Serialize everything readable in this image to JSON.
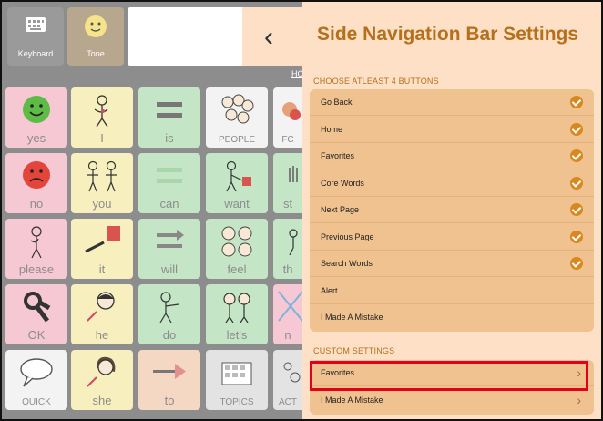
{
  "toolbar": {
    "keyboard_label": "Keyboard",
    "tone_label": "Tone",
    "home_link": "HO"
  },
  "grid": {
    "cells": [
      {
        "label": "yes"
      },
      {
        "label": "I"
      },
      {
        "label": "is"
      },
      {
        "label": "PEOPLE"
      },
      {
        "label": "FC"
      },
      {
        "label": "no"
      },
      {
        "label": "you"
      },
      {
        "label": "can"
      },
      {
        "label": "want"
      },
      {
        "label": "st"
      },
      {
        "label": "please"
      },
      {
        "label": "it"
      },
      {
        "label": "will"
      },
      {
        "label": "feel"
      },
      {
        "label": "th"
      },
      {
        "label": "OK"
      },
      {
        "label": "he"
      },
      {
        "label": "do"
      },
      {
        "label": "let's"
      },
      {
        "label": "n"
      },
      {
        "label": "QUICK"
      },
      {
        "label": "she"
      },
      {
        "label": "to"
      },
      {
        "label": "TOPICS"
      },
      {
        "label": "ACT"
      }
    ]
  },
  "panel": {
    "title": "Side Navigation Bar Settings",
    "section1_header": "CHOOSE ATLEAST 4 BUTTONS",
    "buttons": [
      {
        "label": "Go Back",
        "checked": true
      },
      {
        "label": "Home",
        "checked": true
      },
      {
        "label": "Favorites",
        "checked": true
      },
      {
        "label": "Core Words",
        "checked": true
      },
      {
        "label": "Next Page",
        "checked": true
      },
      {
        "label": "Previous Page",
        "checked": true
      },
      {
        "label": "Search Words",
        "checked": true
      },
      {
        "label": "Alert",
        "checked": false
      },
      {
        "label": "I Made A Mistake",
        "checked": false
      }
    ],
    "section2_header": "CUSTOM SETTINGS",
    "custom": [
      {
        "label": "Favorites"
      },
      {
        "label": "I Made A Mistake"
      }
    ]
  },
  "colors": {
    "accent": "#b4701c",
    "check": "#d9871f",
    "highlight": "#e3001b",
    "panel_bg": "#fde0c5"
  }
}
